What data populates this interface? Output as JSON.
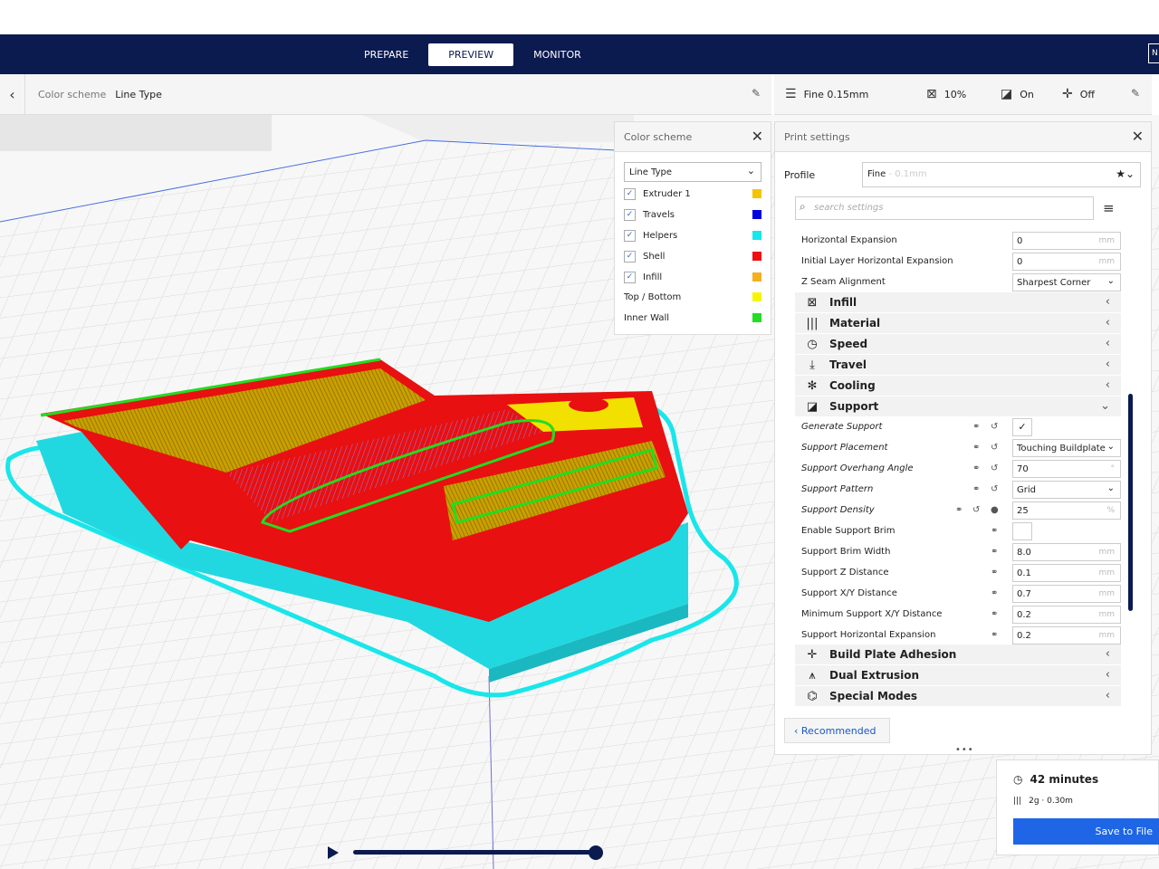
{
  "header": {
    "tabs": [
      {
        "label": "PREPARE",
        "active": false
      },
      {
        "label": "PREVIEW",
        "active": true
      },
      {
        "label": "MONITOR",
        "active": false
      }
    ],
    "corner_label": "N"
  },
  "color_scheme_bar": {
    "label": "Color scheme",
    "value": "Line Type"
  },
  "print_bar": {
    "profile": "Fine 0.15mm",
    "infill": "10%",
    "support": "On",
    "adhesion": "Off"
  },
  "color_scheme_panel": {
    "title": "Color scheme",
    "selected": "Line Type",
    "items": [
      {
        "label": "Extruder 1",
        "checked": true,
        "color": "#f5c400"
      },
      {
        "label": "Travels",
        "checked": true,
        "color": "#0000e0"
      },
      {
        "label": "Helpers",
        "checked": true,
        "color": "#19e6ea"
      },
      {
        "label": "Shell",
        "checked": true,
        "color": "#ee1010"
      },
      {
        "label": "Infill",
        "checked": true,
        "color": "#f5b021"
      },
      {
        "label": "Top / Bottom",
        "checked": null,
        "color": "#f5f500"
      },
      {
        "label": "Inner Wall",
        "checked": null,
        "color": "#22dd22"
      }
    ]
  },
  "print_settings": {
    "title": "Print settings",
    "profile_label": "Profile",
    "profile_value": "Fine",
    "profile_sub": " - 0.1mm",
    "search_placeholder": "search settings",
    "pre_rows": [
      {
        "label": "Horizontal Expansion",
        "value": "0",
        "unit": "mm"
      },
      {
        "label": "Initial Layer Horizontal Expansion",
        "value": "0",
        "unit": "mm"
      },
      {
        "label": "Z Seam Alignment",
        "value": "Sharpest Corner",
        "dropdown": true
      }
    ],
    "categories_top": [
      {
        "label": "Infill",
        "icon": "infill-icon"
      },
      {
        "label": "Material",
        "icon": "material-icon"
      },
      {
        "label": "Speed",
        "icon": "speed-icon"
      },
      {
        "label": "Travel",
        "icon": "travel-icon"
      },
      {
        "label": "Cooling",
        "icon": "cooling-icon"
      },
      {
        "label": "Support",
        "icon": "support-icon"
      }
    ],
    "support_rows": [
      {
        "label": "Generate Support",
        "checkbox": true,
        "checked": true
      },
      {
        "label": "Support Placement",
        "value": "Touching Buildplate",
        "dropdown": true
      },
      {
        "label": "Support Overhang Angle",
        "value": "70",
        "unit": "°"
      },
      {
        "label": "Support Pattern",
        "value": "Grid",
        "dropdown": true
      },
      {
        "label": "Support Density",
        "value": "25",
        "unit": "%"
      },
      {
        "label": "Enable Support Brim",
        "checkbox": true,
        "checked": false
      },
      {
        "label": "Support Brim Width",
        "value": "8.0",
        "unit": "mm"
      },
      {
        "label": "Support Z Distance",
        "value": "0.1",
        "unit": "mm"
      },
      {
        "label": "Support X/Y Distance",
        "value": "0.7",
        "unit": "mm"
      },
      {
        "label": "Minimum Support X/Y Distance",
        "value": "0.2",
        "unit": "mm"
      },
      {
        "label": "Support Horizontal Expansion",
        "value": "0.2",
        "unit": "mm"
      }
    ],
    "categories_bottom": [
      {
        "label": "Build Plate Adhesion"
      },
      {
        "label": "Dual Extrusion"
      },
      {
        "label": "Special Modes"
      }
    ],
    "recommended_label": "Recommended"
  },
  "estimate": {
    "time": "42 minutes",
    "material": "2g · 0.30m",
    "save_label": "Save to File"
  }
}
